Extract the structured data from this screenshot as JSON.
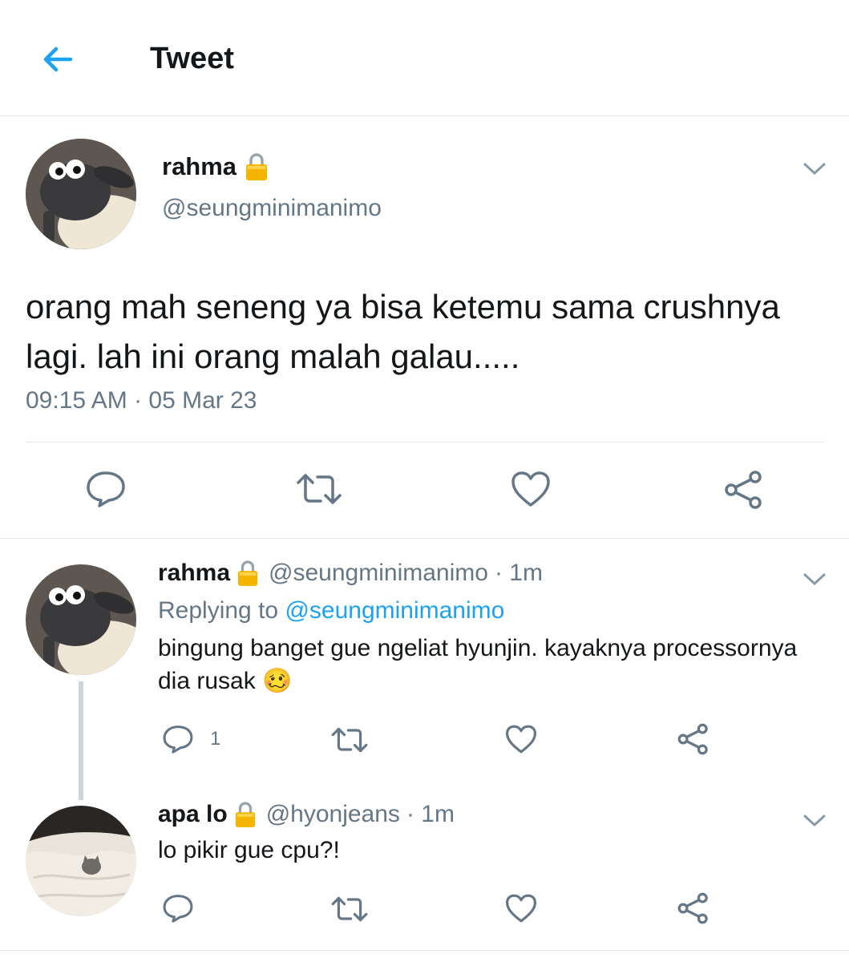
{
  "header": {
    "title": "Tweet"
  },
  "main_tweet": {
    "name": "rahma",
    "handle": "@seungminimanimo",
    "text": "orang mah seneng ya bisa ketemu sama crushnya lagi. lah ini orang malah galau.....",
    "timestamp": "09:15 AM · 05 Mar 23"
  },
  "replies": [
    {
      "name": "rahma",
      "handle": "@seungminimanimo",
      "time": "· 1m",
      "replying_prefix": "Replying to ",
      "replying_to": "@seungminimanimo",
      "text": "bingung banget gue ngeliat hyunjin. kayaknya processornya dia rusak",
      "emoji": "🥴",
      "reply_count": "1"
    },
    {
      "name": "apa lo",
      "handle": "@hyonjeans",
      "time": "· 1m",
      "text": "lo pikir gue cpu?!"
    }
  ],
  "icons": {
    "back": "arrow-left-icon",
    "lock": "lock-icon",
    "menu": "chevron-down-icon",
    "reply": "reply-icon",
    "retweet": "retweet-icon",
    "like": "heart-icon",
    "share": "share-icon"
  },
  "colors": {
    "accent": "#1da1f2",
    "muted": "#657786",
    "icon": "#657786",
    "divider": "#e1e8ed"
  }
}
